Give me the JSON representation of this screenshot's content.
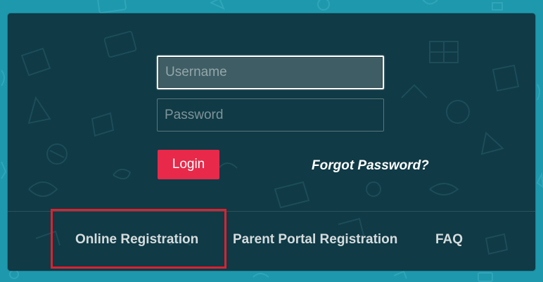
{
  "login_form": {
    "username_placeholder": "Username",
    "password_placeholder": "Password",
    "login_label": "Login",
    "forgot_password_label": "Forgot Password?"
  },
  "footer": {
    "links": [
      {
        "label": "Online Registration"
      },
      {
        "label": "Parent Portal Registration"
      },
      {
        "label": "FAQ"
      }
    ]
  },
  "colors": {
    "page_background": "#1e98ad",
    "panel_background": "#0f3a46",
    "login_button": "#e8294a",
    "highlight_box": "#e0202e",
    "link_text": "#d6dcdd"
  },
  "annotation": {
    "highlighted_item": "Online Registration"
  }
}
